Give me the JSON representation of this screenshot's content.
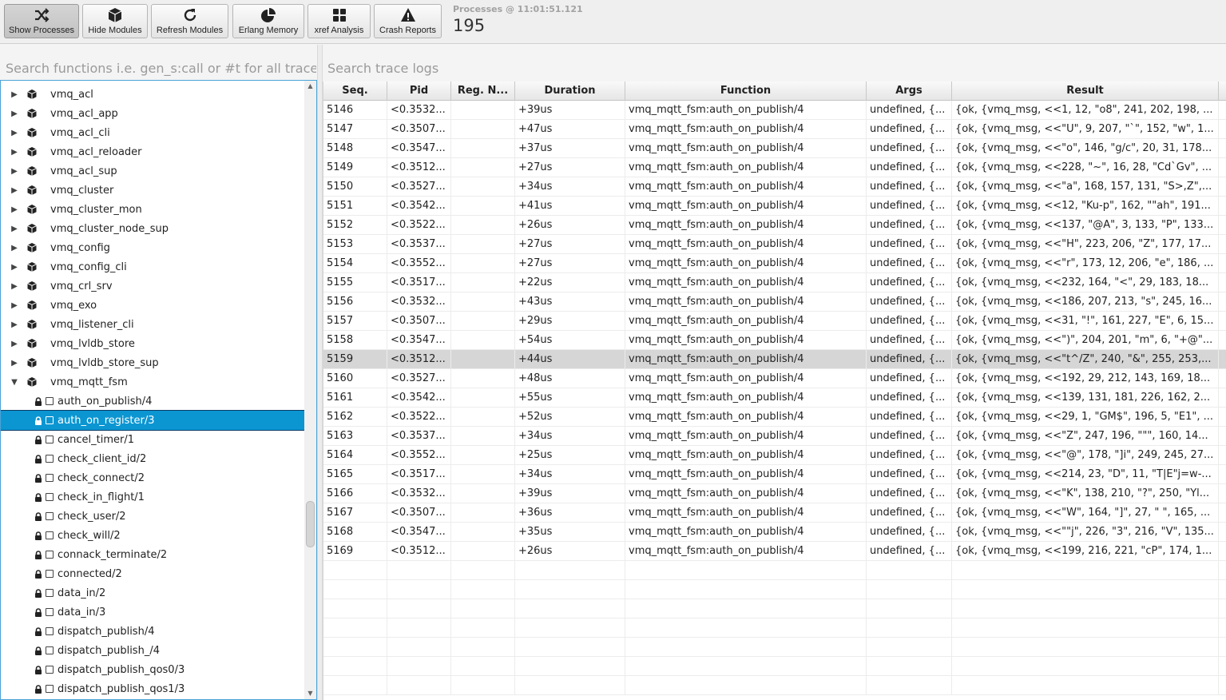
{
  "toolbar": {
    "buttons": [
      {
        "label": "Show Processes",
        "icon": "shuffle-icon"
      },
      {
        "label": "Hide Modules",
        "icon": "cube-icon"
      },
      {
        "label": "Refresh Modules",
        "icon": "refresh-icon"
      },
      {
        "label": "Erlang Memory",
        "icon": "pie-chart-icon"
      },
      {
        "label": "xref Analysis",
        "icon": "grid-icon"
      },
      {
        "label": "Crash Reports",
        "icon": "warning-icon"
      }
    ],
    "processes_caption": "Processes @ 11:01:51.121",
    "processes_count": "195"
  },
  "left_panel": {
    "search_placeholder": "Search functions i.e. gen_s:call or #t for all traces",
    "modules": [
      "vmq_acl",
      "vmq_acl_app",
      "vmq_acl_cli",
      "vmq_acl_reloader",
      "vmq_acl_sup",
      "vmq_cluster",
      "vmq_cluster_mon",
      "vmq_cluster_node_sup",
      "vmq_config",
      "vmq_config_cli",
      "vmq_crl_srv",
      "vmq_exo",
      "vmq_listener_cli",
      "vmq_lvldb_store",
      "vmq_lvldb_store_sup",
      "vmq_mqtt_fsm"
    ],
    "expanded_module": "vmq_mqtt_fsm",
    "functions": [
      "auth_on_publish/4",
      "auth_on_register/3",
      "cancel_timer/1",
      "check_client_id/2",
      "check_connect/2",
      "check_in_flight/1",
      "check_user/2",
      "check_will/2",
      "connack_terminate/2",
      "connected/2",
      "data_in/2",
      "data_in/3",
      "dispatch_publish/4",
      "dispatch_publish_/4",
      "dispatch_publish_qos0/3",
      "dispatch_publish_qos1/3"
    ],
    "selected_function": "auth_on_register/3"
  },
  "trace": {
    "search_placeholder": "Search trace logs",
    "columns": [
      "Seq.",
      "Pid",
      "Reg. N...",
      "Duration",
      "Function",
      "Args",
      "Result"
    ],
    "selected_seq": "5159",
    "rows": [
      [
        "5146",
        "<0.3532...",
        "",
        "+39us",
        "vmq_mqtt_fsm:auth_on_publish/4",
        "undefined, {...",
        "{ok, {vmq_msg, <<1, 12, \"o8\", 241, 202, 198, ..."
      ],
      [
        "5147",
        "<0.3507...",
        "",
        "+47us",
        "vmq_mqtt_fsm:auth_on_publish/4",
        "undefined, {...",
        "{ok, {vmq_msg, <<\"U\", 9, 207, \"`\", 152, \"w\", 1..."
      ],
      [
        "5148",
        "<0.3547...",
        "",
        "+37us",
        "vmq_mqtt_fsm:auth_on_publish/4",
        "undefined, {...",
        "{ok, {vmq_msg, <<\"o\", 146, \"g/c\", 20, 31, 178..."
      ],
      [
        "5149",
        "<0.3512...",
        "",
        "+27us",
        "vmq_mqtt_fsm:auth_on_publish/4",
        "undefined, {...",
        "{ok, {vmq_msg, <<228, \"~\", 16, 28, \"Cd`Gv\", ..."
      ],
      [
        "5150",
        "<0.3527...",
        "",
        "+34us",
        "vmq_mqtt_fsm:auth_on_publish/4",
        "undefined, {...",
        "{ok, {vmq_msg, <<\"a\", 168, 157, 131, \"S>,Z\",..."
      ],
      [
        "5151",
        "<0.3542...",
        "",
        "+41us",
        "vmq_mqtt_fsm:auth_on_publish/4",
        "undefined, {...",
        "{ok, {vmq_msg, <<12, \"Ku-p\", 162, \"\"ah\", 191..."
      ],
      [
        "5152",
        "<0.3522...",
        "",
        "+26us",
        "vmq_mqtt_fsm:auth_on_publish/4",
        "undefined, {...",
        "{ok, {vmq_msg, <<137, \"@A\", 3, 133, \"P\", 133..."
      ],
      [
        "5153",
        "<0.3537...",
        "",
        "+27us",
        "vmq_mqtt_fsm:auth_on_publish/4",
        "undefined, {...",
        "{ok, {vmq_msg, <<\"H\", 223, 206, \"Z\", 177, 17..."
      ],
      [
        "5154",
        "<0.3552...",
        "",
        "+27us",
        "vmq_mqtt_fsm:auth_on_publish/4",
        "undefined, {...",
        "{ok, {vmq_msg, <<\"r\", 173, 12, 206, \"e\", 186, ..."
      ],
      [
        "5155",
        "<0.3517...",
        "",
        "+22us",
        "vmq_mqtt_fsm:auth_on_publish/4",
        "undefined, {...",
        "{ok, {vmq_msg, <<232, 164, \"<\", 29, 183, 18..."
      ],
      [
        "5156",
        "<0.3532...",
        "",
        "+43us",
        "vmq_mqtt_fsm:auth_on_publish/4",
        "undefined, {...",
        "{ok, {vmq_msg, <<186, 207, 213, \"s\", 245, 16..."
      ],
      [
        "5157",
        "<0.3507...",
        "",
        "+29us",
        "vmq_mqtt_fsm:auth_on_publish/4",
        "undefined, {...",
        "{ok, {vmq_msg, <<31, \"!\", 161, 227, \"E\", 6, 15..."
      ],
      [
        "5158",
        "<0.3547...",
        "",
        "+54us",
        "vmq_mqtt_fsm:auth_on_publish/4",
        "undefined, {...",
        "{ok, {vmq_msg, <<\")\", 204, 201, \"m\", 6, \"+@\"..."
      ],
      [
        "5159",
        "<0.3512...",
        "",
        "+44us",
        "vmq_mqtt_fsm:auth_on_publish/4",
        "undefined, {...",
        "{ok, {vmq_msg, <<\"t^/Z\", 240, \"&\", 255, 253,..."
      ],
      [
        "5160",
        "<0.3527...",
        "",
        "+48us",
        "vmq_mqtt_fsm:auth_on_publish/4",
        "undefined, {...",
        "{ok, {vmq_msg, <<192, 29, 212, 143, 169, 18..."
      ],
      [
        "5161",
        "<0.3542...",
        "",
        "+55us",
        "vmq_mqtt_fsm:auth_on_publish/4",
        "undefined, {...",
        "{ok, {vmq_msg, <<139, 131, 181, 226, 162, 2..."
      ],
      [
        "5162",
        "<0.3522...",
        "",
        "+52us",
        "vmq_mqtt_fsm:auth_on_publish/4",
        "undefined, {...",
        "{ok, {vmq_msg, <<29, 1, \"GM$\", 196, 5, \"E1\", ..."
      ],
      [
        "5163",
        "<0.3537...",
        "",
        "+34us",
        "vmq_mqtt_fsm:auth_on_publish/4",
        "undefined, {...",
        "{ok, {vmq_msg, <<\"Z\", 247, 196, \"\"\", 160, 14..."
      ],
      [
        "5164",
        "<0.3552...",
        "",
        "+25us",
        "vmq_mqtt_fsm:auth_on_publish/4",
        "undefined, {...",
        "{ok, {vmq_msg, <<\"@\", 178, \"]i\", 249, 245, 27..."
      ],
      [
        "5165",
        "<0.3517...",
        "",
        "+34us",
        "vmq_mqtt_fsm:auth_on_publish/4",
        "undefined, {...",
        "{ok, {vmq_msg, <<214, 23, \"D\", 11, \"T|E\"j=w-..."
      ],
      [
        "5166",
        "<0.3532...",
        "",
        "+39us",
        "vmq_mqtt_fsm:auth_on_publish/4",
        "undefined, {...",
        "{ok, {vmq_msg, <<\"K\", 138, 210, \"?\", 250, \"Yl..."
      ],
      [
        "5167",
        "<0.3507...",
        "",
        "+36us",
        "vmq_mqtt_fsm:auth_on_publish/4",
        "undefined, {...",
        "{ok, {vmq_msg, <<\"W\", 164, \"]\", 27, \" \", 165, ..."
      ],
      [
        "5168",
        "<0.3547...",
        "",
        "+35us",
        "vmq_mqtt_fsm:auth_on_publish/4",
        "undefined, {...",
        "{ok, {vmq_msg, <<\"\"j\", 226, \"3\", 216, \"V\", 135..."
      ],
      [
        "5169",
        "<0.3512...",
        "",
        "+26us",
        "vmq_mqtt_fsm:auth_on_publish/4",
        "undefined, {...",
        "{ok, {vmq_msg, <<199, 216, 221, \"cP\", 174, 1..."
      ]
    ]
  },
  "colors": {
    "selection_blue": "#0b96d2",
    "selected_row_gray": "#d6d6d6",
    "focus_border": "#4aa3d6"
  }
}
